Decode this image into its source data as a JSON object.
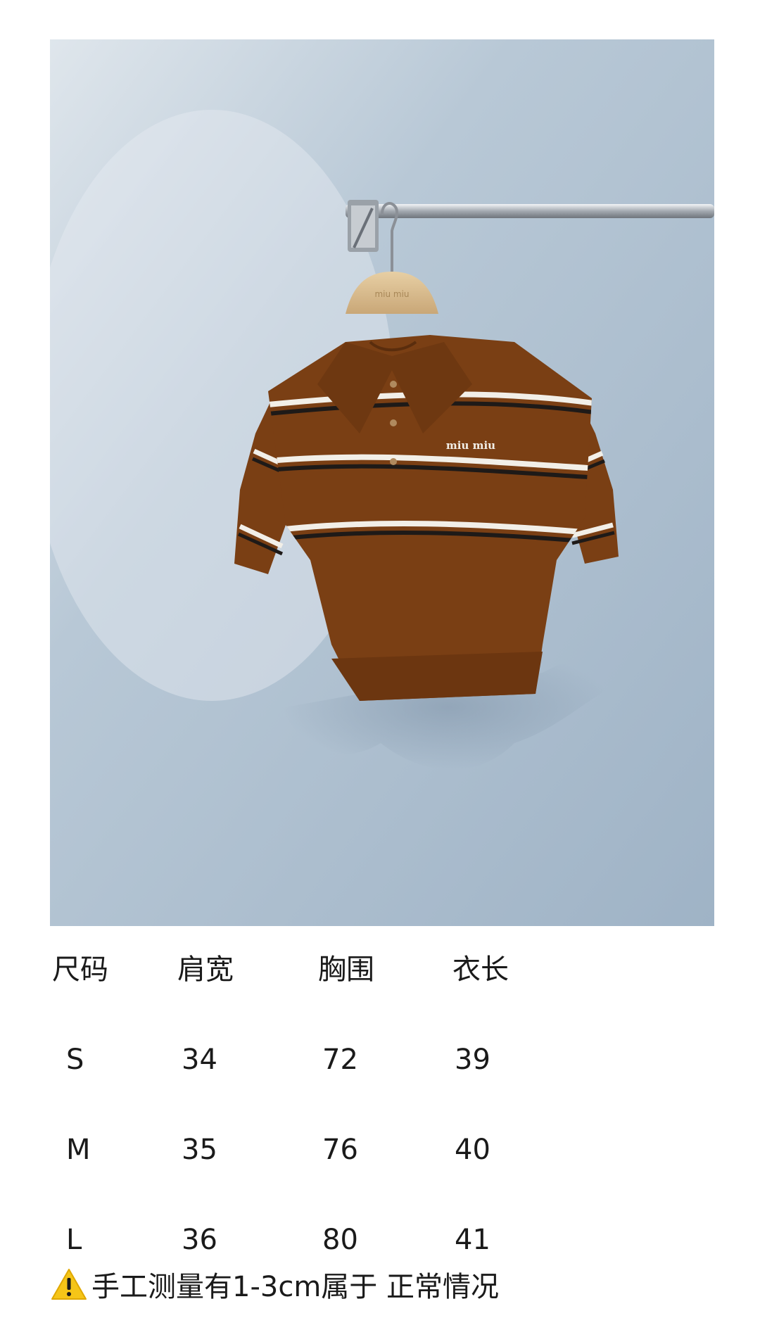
{
  "product": {
    "photo_name": "miu miu striped knit polo top on hanger",
    "logo_text": "miu miu",
    "hanger_text": "miu miu"
  },
  "size_chart": {
    "headers": [
      "尺码",
      "肩宽",
      "胸围",
      "衣长"
    ],
    "rows": [
      [
        "S",
        "34",
        "72",
        "39"
      ],
      [
        "M",
        "35",
        "76",
        "40"
      ],
      [
        "L",
        "36",
        "80",
        "41"
      ]
    ]
  },
  "note": {
    "icon": "warning-icon",
    "text": "手工测量有1-3cm属于 正常情况"
  },
  "colors": {
    "wall": "#a9bccd",
    "garment": "#7a3f14",
    "stripe_white": "#f2efe8",
    "stripe_black": "#1e1a18",
    "warning": "#f5c518"
  }
}
